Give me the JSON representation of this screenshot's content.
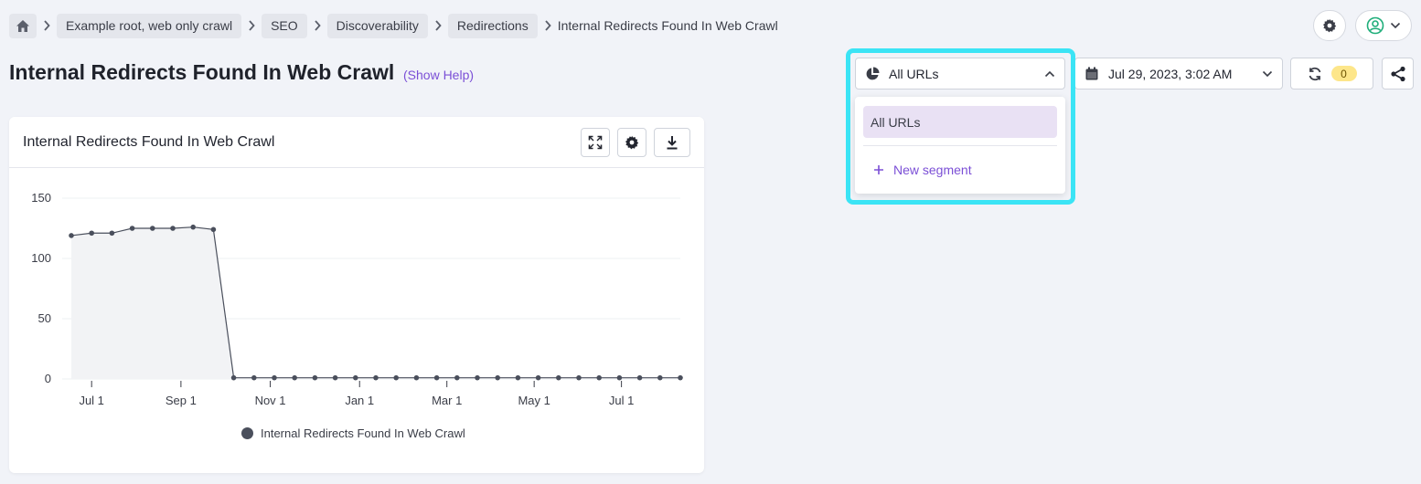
{
  "breadcrumb": {
    "items": [
      "Example root, web only crawl",
      "SEO",
      "Discoverability",
      "Redirections"
    ],
    "current": "Internal Redirects Found In Web Crawl"
  },
  "page": {
    "title": "Internal Redirects Found In Web Crawl",
    "show_help": "(Show Help)"
  },
  "controls": {
    "segment_label": "All URLs",
    "date_label": "Jul 29, 2023, 3:02 AM",
    "refresh_count": "0"
  },
  "dropdown": {
    "active_item": "All URLs",
    "new_segment": "New segment"
  },
  "card": {
    "title": "Internal Redirects Found In Web Crawl"
  },
  "colors": {
    "accent": "#7b4fd6",
    "highlight": "#3be4f5",
    "series": "#4a4f5c",
    "area": "#f2f3f5"
  },
  "chart_data": {
    "type": "area",
    "title": "Internal Redirects Found In Web Crawl",
    "xlabel": "",
    "ylabel": "",
    "ylim": [
      0,
      150
    ],
    "yticks": [
      0,
      50,
      100,
      150
    ],
    "xticks": [
      "Jul 1",
      "Sep 1",
      "Nov 1",
      "Jan 1",
      "Mar 1",
      "May 1",
      "Jul 1"
    ],
    "grid": true,
    "legend": "bottom-center",
    "series": [
      {
        "name": "Internal Redirects Found In Web Crawl",
        "values": [
          119,
          121,
          121,
          125,
          125,
          125,
          126,
          124,
          1,
          1,
          1,
          1,
          1,
          1,
          1,
          1,
          1,
          1,
          1,
          1,
          1,
          1,
          1,
          1,
          1,
          1,
          1,
          1,
          1,
          1,
          1
        ]
      }
    ]
  }
}
